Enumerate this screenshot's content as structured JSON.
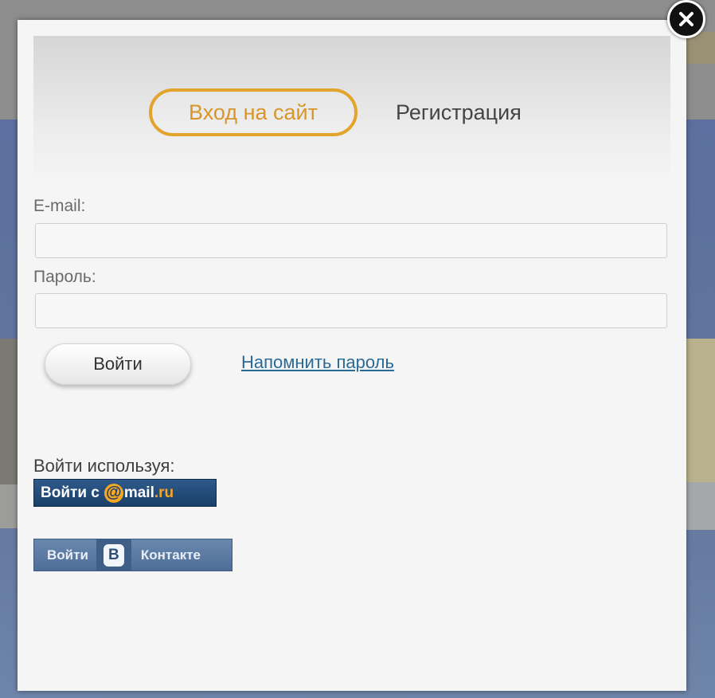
{
  "tabs": {
    "login": "Вход на сайт",
    "register": "Регистрация"
  },
  "form": {
    "email_label": "E-mail:",
    "email_value": "",
    "password_label": "Пароль:",
    "password_value": "",
    "submit_label": "Войти",
    "remind_link": "Напомнить пароль"
  },
  "social": {
    "label": "Войти используя:",
    "mailru": {
      "prefix": "Войти с",
      "at": "@",
      "brand": "mail",
      "suffix": ".ru"
    },
    "vk": {
      "prefix": "Войти",
      "logo_letter": "В",
      "suffix": "Контакте"
    }
  },
  "colors": {
    "active_tab": "#e3a42e",
    "link": "#2a6a96",
    "mailru_bg": "#1a3f6a",
    "vk_bg": "#4f6e97"
  },
  "icons": {
    "close": "close-icon"
  }
}
